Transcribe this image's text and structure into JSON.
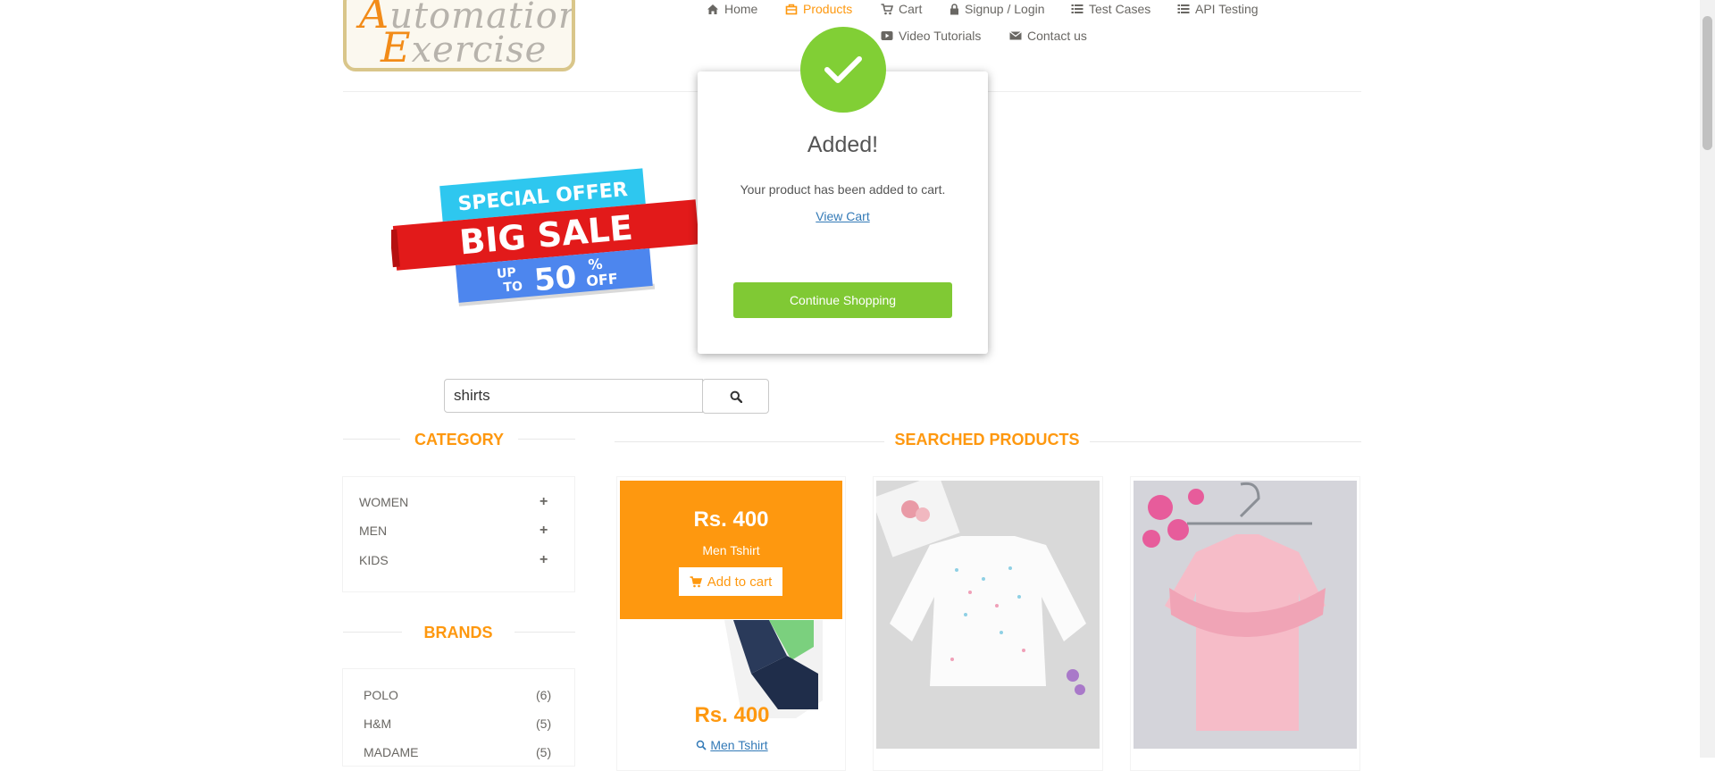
{
  "logo": {
    "line1_cap": "A",
    "line1_rest": "utomation",
    "line2_cap": "E",
    "line2_rest": "xercise"
  },
  "nav": {
    "home": "Home",
    "products": "Products",
    "cart": "Cart",
    "signup": "Signup / Login",
    "test_cases": "Test Cases",
    "api_testing": "API Testing",
    "video_tutorials": "Video Tutorials",
    "contact_us": "Contact us"
  },
  "banner": {
    "line1": "SPECIAL OFFER",
    "line2": "BIG SALE",
    "up": "UP",
    "to": "TO",
    "percent_value": "50",
    "percent_sign": "%",
    "off": "OFF"
  },
  "modal": {
    "title": "Added!",
    "message": "Your product has been added to cart.",
    "view_cart": "View Cart",
    "continue": "Continue Shopping"
  },
  "search": {
    "value": "shirts"
  },
  "sidebar": {
    "category_title": "CATEGORY",
    "categories": [
      "WOMEN",
      "MEN",
      "KIDS"
    ],
    "brands_title": "BRANDS",
    "brands": [
      {
        "name": "POLO",
        "count": "(6)"
      },
      {
        "name": "H&M",
        "count": "(5)"
      },
      {
        "name": "MADAME",
        "count": "(5)"
      }
    ]
  },
  "products": {
    "title": "SEARCHED PRODUCTS",
    "items": [
      {
        "overlay_price": "Rs. 400",
        "overlay_name": "Men Tshirt",
        "add_label": "Add to cart",
        "price": "Rs. 400",
        "view_label": "Men Tshirt"
      }
    ]
  },
  "colors": {
    "accent": "#FE980F",
    "success": "#81CF35"
  }
}
